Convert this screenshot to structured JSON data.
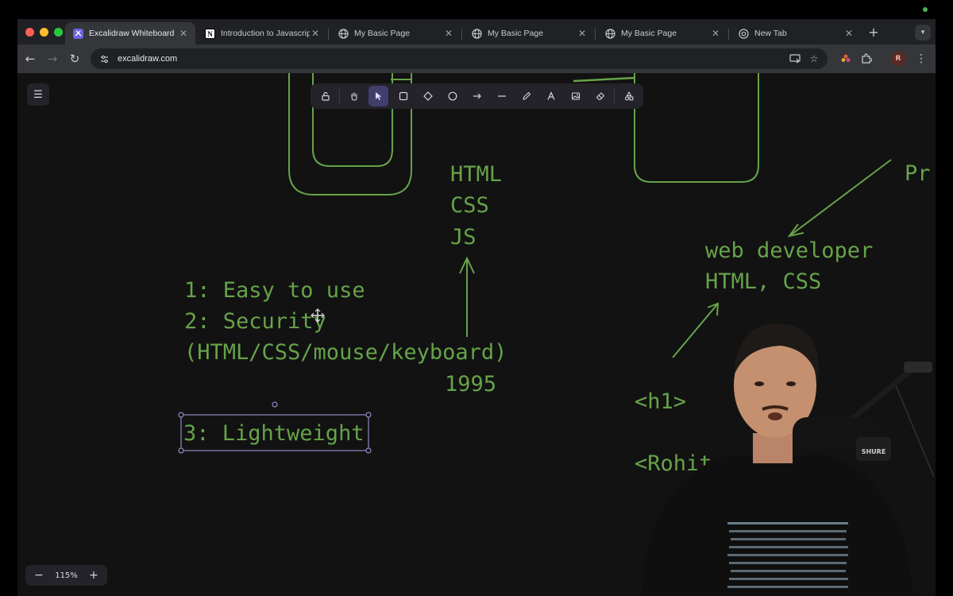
{
  "browser": {
    "tabs": [
      {
        "title": "Excalidraw Whiteboard",
        "icon": "excalidraw-icon",
        "active": true
      },
      {
        "title": "Introduction to Javascript",
        "icon": "notion-icon",
        "active": false
      },
      {
        "title": "My Basic Page",
        "icon": "globe-icon",
        "active": false
      },
      {
        "title": "My Basic Page",
        "icon": "globe-icon",
        "active": false
      },
      {
        "title": "My Basic Page",
        "icon": "globe-icon",
        "active": false
      },
      {
        "title": "New Tab",
        "icon": "chrome-icon",
        "active": false
      }
    ],
    "url": "excalidraw.com",
    "profile_initial": "R"
  },
  "excalidraw": {
    "zoom": "115%",
    "tools": [
      "lock",
      "hand",
      "selection",
      "rectangle",
      "diamond",
      "ellipse",
      "arrow",
      "line",
      "draw",
      "text",
      "image",
      "eraser",
      "extra-tools"
    ],
    "selected_tool": "selection"
  },
  "canvas_text": {
    "languages": [
      "HTML",
      "CSS",
      "JS"
    ],
    "features": [
      "1: Easy to use",
      "2: Security",
      "(HTML/CSS/mouse/keyboard)"
    ],
    "year": "1995",
    "lightweight": "3: Lightweight",
    "web_dev": [
      "web developer",
      "HTML, CSS"
    ],
    "pr": "Pr",
    "h1_tag": "<h1>",
    "rohit_tag": "<Rohit"
  },
  "colors": {
    "canvas_bg": "#121212",
    "ink": "#66a34a",
    "selection": "#a5a1e8",
    "toolbar_bg": "#232329",
    "tool_selected": "#403e6a"
  }
}
